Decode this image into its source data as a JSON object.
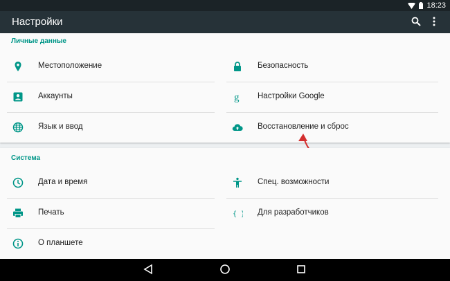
{
  "status_bar": {
    "time": "18:23"
  },
  "toolbar": {
    "title": "Настройки"
  },
  "sections": [
    {
      "title": "Личные данные",
      "items": [
        {
          "label": "Местоположение",
          "icon": "location-icon"
        },
        {
          "label": "Безопасность",
          "icon": "lock-icon"
        },
        {
          "label": "Аккаунты",
          "icon": "account-icon"
        },
        {
          "label": "Настройки Google",
          "icon": "google-icon"
        },
        {
          "label": "Язык и ввод",
          "icon": "globe-icon"
        },
        {
          "label": "Восстановление и сброс",
          "icon": "cloud-upload-icon"
        }
      ]
    },
    {
      "title": "Система",
      "items": [
        {
          "label": "Дата и время",
          "icon": "clock-icon"
        },
        {
          "label": "Спец. возможности",
          "icon": "accessibility-icon"
        },
        {
          "label": "Печать",
          "icon": "printer-icon"
        },
        {
          "label": "Для разработчиков",
          "icon": "developer-braces-icon"
        },
        {
          "label": "О планшете",
          "icon": "info-icon"
        }
      ]
    }
  ],
  "colors": {
    "accent": "#009688",
    "toolbar": "#263238",
    "status_bar": "#1b2327",
    "annotation_arrow": "#d32f2f"
  }
}
